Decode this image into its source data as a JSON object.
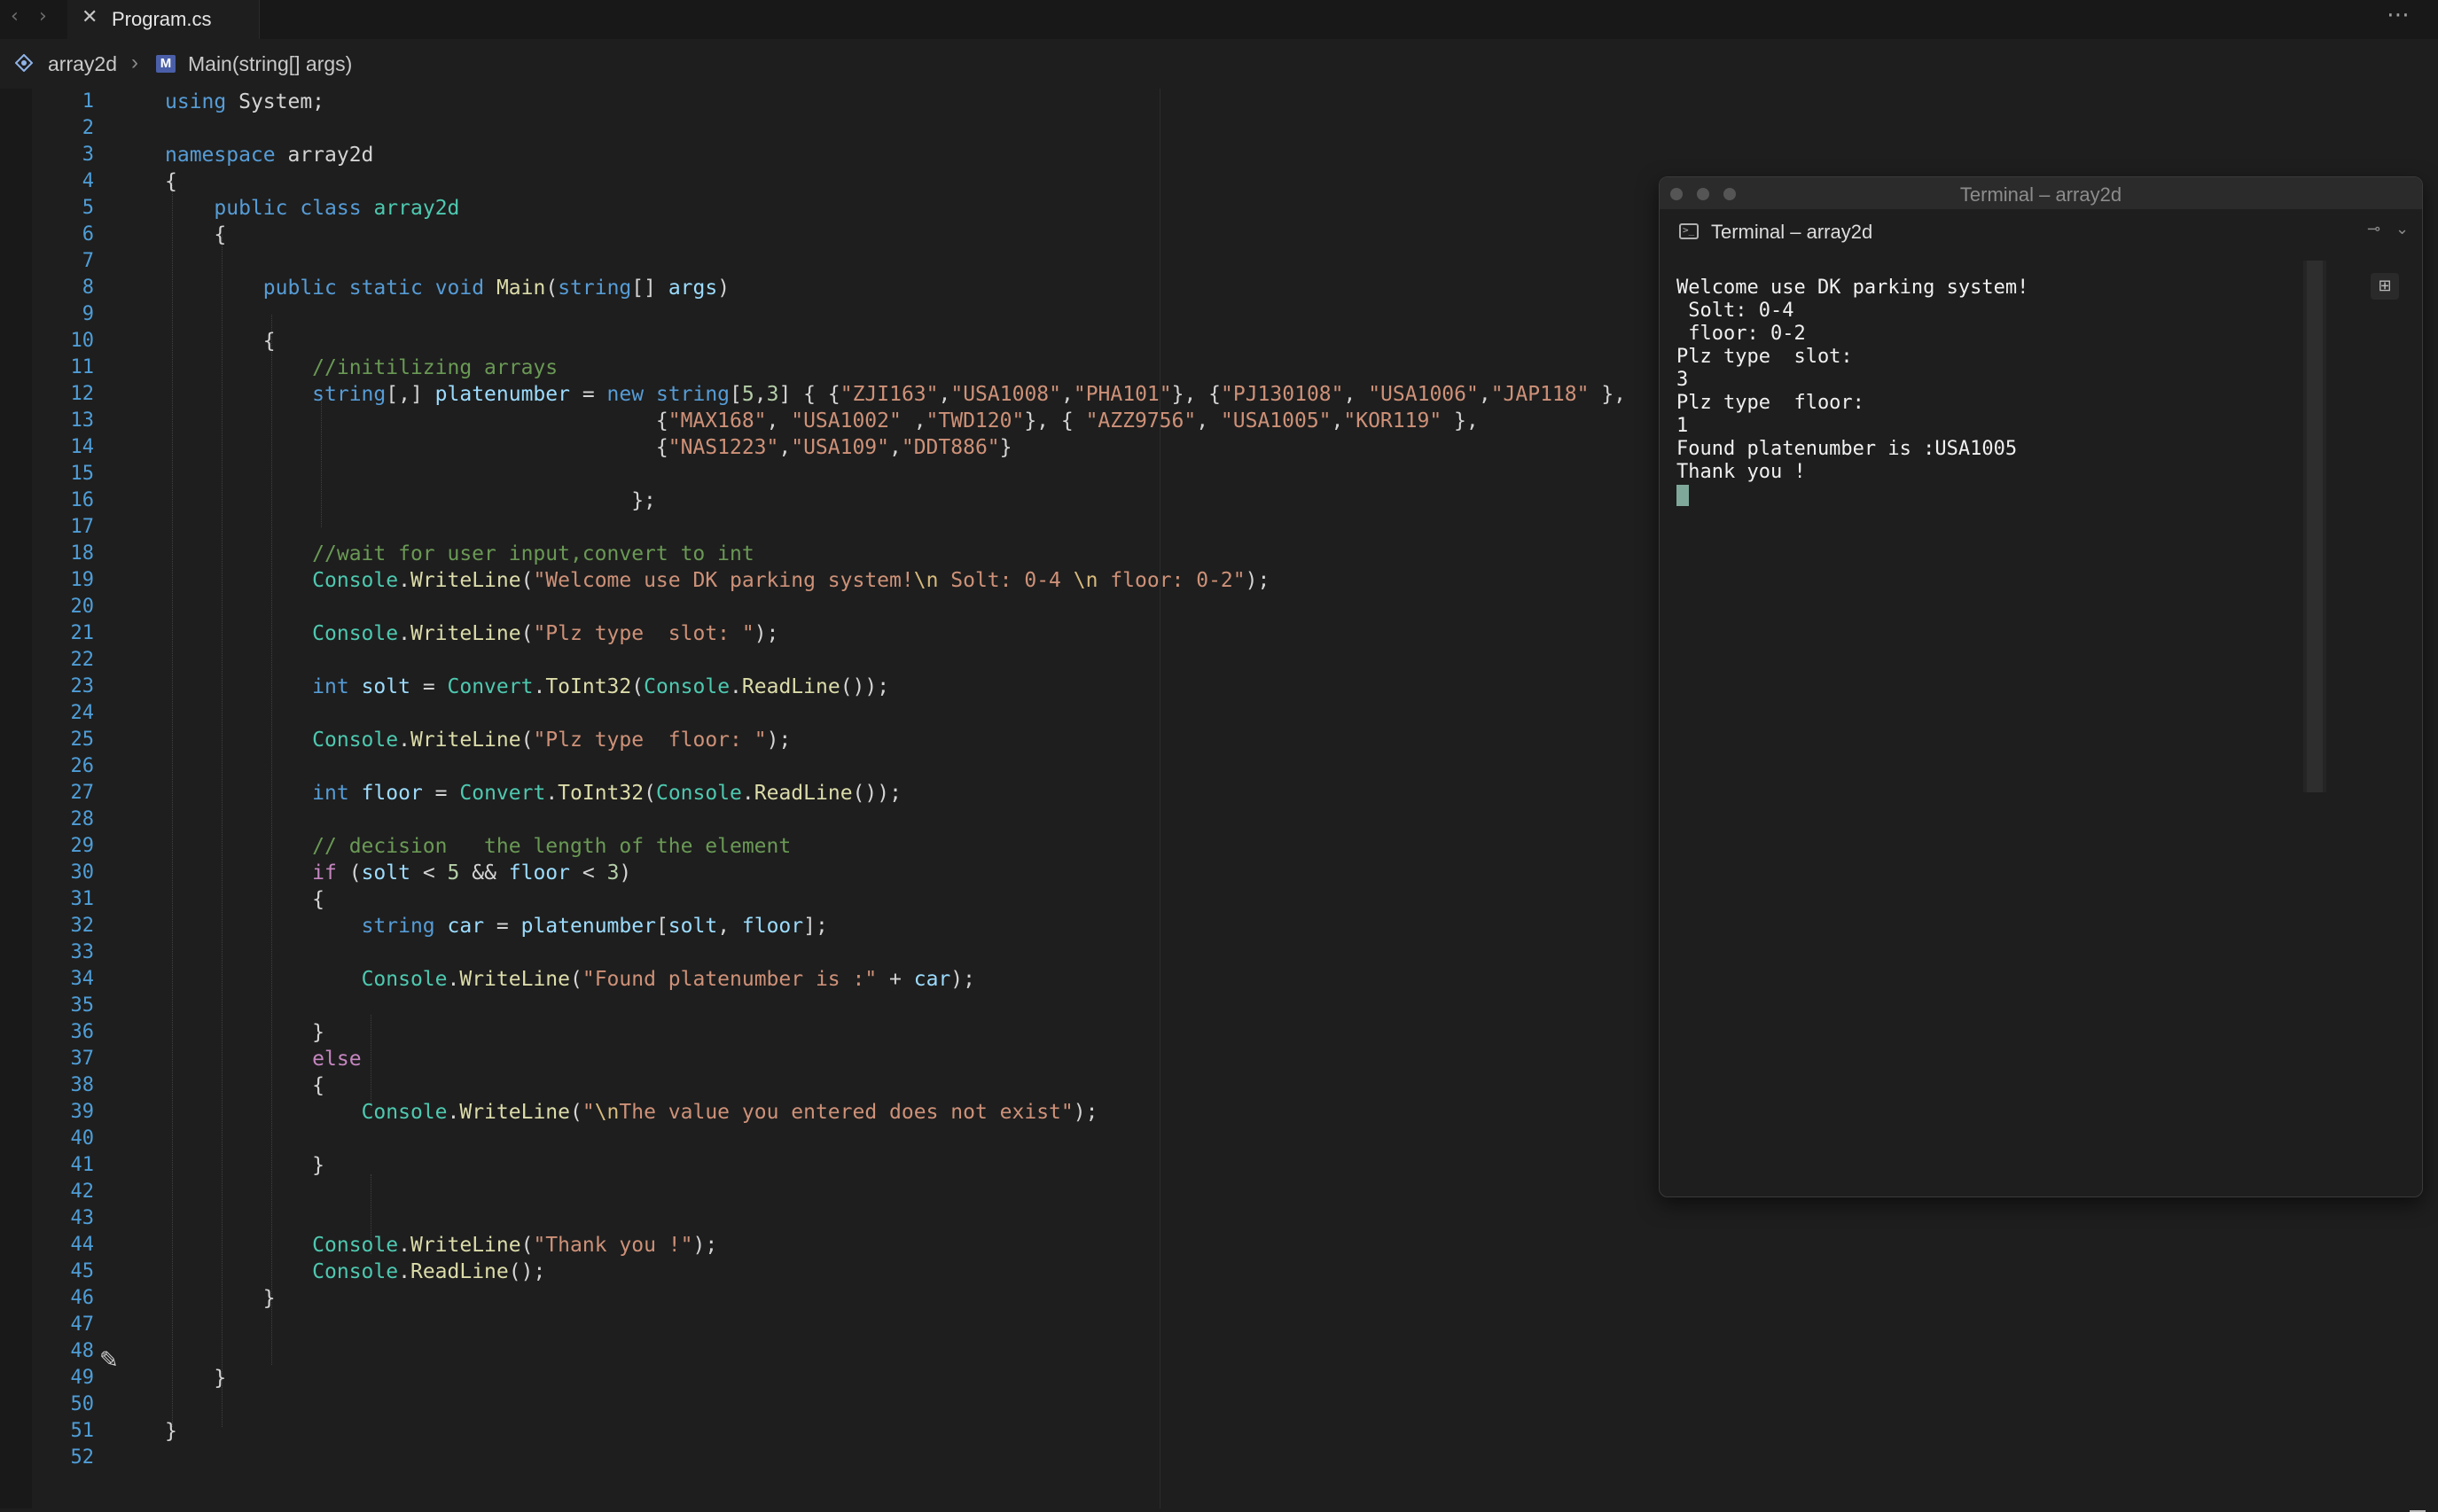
{
  "tabbar": {
    "back_icon": "chevron-left-icon",
    "forward_icon": "chevron-right-icon",
    "active_tab": {
      "label": "Program.cs",
      "close_icon": "close-icon"
    },
    "more_icon": "ellipsis-icon"
  },
  "breadcrumb": {
    "namespace": "array2d",
    "separator": "›",
    "method": "Main(string[] args)"
  },
  "editor": {
    "line_count": 52,
    "lines": [
      [
        [
          "kw",
          "using"
        ],
        [
          "t",
          " System;"
        ]
      ],
      [],
      [
        [
          "kw",
          "namespace"
        ],
        [
          "t",
          " array2d"
        ]
      ],
      [
        [
          "t",
          "{"
        ]
      ],
      [
        [
          "t",
          "    "
        ],
        [
          "kw",
          "public"
        ],
        [
          "t",
          " "
        ],
        [
          "kw",
          "class"
        ],
        [
          "t",
          " "
        ],
        [
          "ty",
          "array2d"
        ]
      ],
      [
        [
          "t",
          "    {"
        ]
      ],
      [],
      [
        [
          "t",
          "        "
        ],
        [
          "kw",
          "public"
        ],
        [
          "t",
          " "
        ],
        [
          "kw",
          "static"
        ],
        [
          "t",
          " "
        ],
        [
          "kw",
          "void"
        ],
        [
          "t",
          " "
        ],
        [
          "fn",
          "Main"
        ],
        [
          "t",
          "("
        ],
        [
          "kw",
          "string"
        ],
        [
          "t",
          "[] "
        ],
        [
          "var",
          "args"
        ],
        [
          "t",
          ")"
        ]
      ],
      [],
      [
        [
          "t",
          "        {"
        ]
      ],
      [
        [
          "t",
          "            "
        ],
        [
          "cmt",
          "//initilizing arrays"
        ]
      ],
      [
        [
          "t",
          "            "
        ],
        [
          "kw",
          "string"
        ],
        [
          "t",
          "[,] "
        ],
        [
          "var",
          "platenumber"
        ],
        [
          "t",
          " = "
        ],
        [
          "kw",
          "new"
        ],
        [
          "t",
          " "
        ],
        [
          "kw",
          "string"
        ],
        [
          "t",
          "["
        ],
        [
          "num",
          "5"
        ],
        [
          "t",
          ","
        ],
        [
          "num",
          "3"
        ],
        [
          "t",
          "] { {"
        ],
        [
          "str",
          "\"ZJI163\""
        ],
        [
          "t",
          ","
        ],
        [
          "str",
          "\"USA1008\""
        ],
        [
          "t",
          ","
        ],
        [
          "str",
          "\"PHA101\""
        ],
        [
          "t",
          "}, {"
        ],
        [
          "str",
          "\"PJ130108\""
        ],
        [
          "t",
          ", "
        ],
        [
          "str",
          "\"USA1006\""
        ],
        [
          "t",
          ","
        ],
        [
          "str",
          "\"JAP118\""
        ],
        [
          "t",
          " },"
        ]
      ],
      [
        [
          "t",
          "                                        {"
        ],
        [
          "str",
          "\"MAX168\""
        ],
        [
          "t",
          ", "
        ],
        [
          "str",
          "\"USA1002\""
        ],
        [
          "t",
          " ,"
        ],
        [
          "str",
          "\"TWD120\""
        ],
        [
          "t",
          "}, { "
        ],
        [
          "str",
          "\"AZZ9756\""
        ],
        [
          "t",
          ", "
        ],
        [
          "str",
          "\"USA1005\""
        ],
        [
          "t",
          ","
        ],
        [
          "str",
          "\"KOR119\""
        ],
        [
          "t",
          " },"
        ]
      ],
      [
        [
          "t",
          "                                        {"
        ],
        [
          "str",
          "\"NAS1223\""
        ],
        [
          "t",
          ","
        ],
        [
          "str",
          "\"USA109\""
        ],
        [
          "t",
          ","
        ],
        [
          "str",
          "\"DDT886\""
        ],
        [
          "t",
          "}"
        ]
      ],
      [],
      [
        [
          "t",
          "                                      };"
        ]
      ],
      [],
      [
        [
          "t",
          "            "
        ],
        [
          "cmt",
          "//wait for user input,convert to int"
        ]
      ],
      [
        [
          "t",
          "            "
        ],
        [
          "ty",
          "Console"
        ],
        [
          "t",
          "."
        ],
        [
          "fn",
          "WriteLine"
        ],
        [
          "t",
          "("
        ],
        [
          "str",
          "\"Welcome use DK parking system!"
        ],
        [
          "esc",
          "\\n"
        ],
        [
          "str",
          " Solt: 0-4 "
        ],
        [
          "esc",
          "\\n"
        ],
        [
          "str",
          " floor: 0-2\""
        ],
        [
          "t",
          ");"
        ]
      ],
      [],
      [
        [
          "t",
          "            "
        ],
        [
          "ty",
          "Console"
        ],
        [
          "t",
          "."
        ],
        [
          "fn",
          "WriteLine"
        ],
        [
          "t",
          "("
        ],
        [
          "str",
          "\"Plz type  slot: \""
        ],
        [
          "t",
          ");"
        ]
      ],
      [],
      [
        [
          "t",
          "            "
        ],
        [
          "kw",
          "int"
        ],
        [
          "t",
          " "
        ],
        [
          "var",
          "solt"
        ],
        [
          "t",
          " = "
        ],
        [
          "ty",
          "Convert"
        ],
        [
          "t",
          "."
        ],
        [
          "fn",
          "ToInt32"
        ],
        [
          "t",
          "("
        ],
        [
          "ty",
          "Console"
        ],
        [
          "t",
          "."
        ],
        [
          "fn",
          "ReadLine"
        ],
        [
          "t",
          "());"
        ]
      ],
      [],
      [
        [
          "t",
          "            "
        ],
        [
          "ty",
          "Console"
        ],
        [
          "t",
          "."
        ],
        [
          "fn",
          "WriteLine"
        ],
        [
          "t",
          "("
        ],
        [
          "str",
          "\"Plz type  floor: \""
        ],
        [
          "t",
          ");"
        ]
      ],
      [],
      [
        [
          "t",
          "            "
        ],
        [
          "kw",
          "int"
        ],
        [
          "t",
          " "
        ],
        [
          "var",
          "floor"
        ],
        [
          "t",
          " = "
        ],
        [
          "ty",
          "Convert"
        ],
        [
          "t",
          "."
        ],
        [
          "fn",
          "ToInt32"
        ],
        [
          "t",
          "("
        ],
        [
          "ty",
          "Console"
        ],
        [
          "t",
          "."
        ],
        [
          "fn",
          "ReadLine"
        ],
        [
          "t",
          "());"
        ]
      ],
      [],
      [
        [
          "t",
          "            "
        ],
        [
          "cmt",
          "// decision   the length of the element"
        ]
      ],
      [
        [
          "t",
          "            "
        ],
        [
          "ctl",
          "if"
        ],
        [
          "t",
          " ("
        ],
        [
          "var",
          "solt"
        ],
        [
          "t",
          " < "
        ],
        [
          "num",
          "5"
        ],
        [
          "t",
          " && "
        ],
        [
          "var",
          "floor"
        ],
        [
          "t",
          " < "
        ],
        [
          "num",
          "3"
        ],
        [
          "t",
          ")"
        ]
      ],
      [
        [
          "t",
          "            {"
        ]
      ],
      [
        [
          "t",
          "                "
        ],
        [
          "kw",
          "string"
        ],
        [
          "t",
          " "
        ],
        [
          "var",
          "car"
        ],
        [
          "t",
          " = "
        ],
        [
          "var",
          "platenumber"
        ],
        [
          "t",
          "["
        ],
        [
          "var",
          "solt"
        ],
        [
          "t",
          ", "
        ],
        [
          "var",
          "floor"
        ],
        [
          "t",
          "];"
        ]
      ],
      [],
      [
        [
          "t",
          "                "
        ],
        [
          "ty",
          "Console"
        ],
        [
          "t",
          "."
        ],
        [
          "fn",
          "WriteLine"
        ],
        [
          "t",
          "("
        ],
        [
          "str",
          "\"Found platenumber is :\""
        ],
        [
          "t",
          " + "
        ],
        [
          "var",
          "car"
        ],
        [
          "t",
          ");"
        ]
      ],
      [],
      [
        [
          "t",
          "            }"
        ]
      ],
      [
        [
          "t",
          "            "
        ],
        [
          "ctl",
          "else"
        ]
      ],
      [
        [
          "t",
          "            {"
        ]
      ],
      [
        [
          "t",
          "                "
        ],
        [
          "ty",
          "Console"
        ],
        [
          "t",
          "."
        ],
        [
          "fn",
          "WriteLine"
        ],
        [
          "t",
          "("
        ],
        [
          "str",
          "\""
        ],
        [
          "esc",
          "\\n"
        ],
        [
          "str",
          "The value you entered does not exist\""
        ],
        [
          "t",
          ");"
        ]
      ],
      [],
      [
        [
          "t",
          "            }"
        ]
      ],
      [],
      [],
      [
        [
          "t",
          "            "
        ],
        [
          "ty",
          "Console"
        ],
        [
          "t",
          "."
        ],
        [
          "fn",
          "WriteLine"
        ],
        [
          "t",
          "("
        ],
        [
          "str",
          "\"Thank you !\""
        ],
        [
          "t",
          ");"
        ]
      ],
      [
        [
          "t",
          "            "
        ],
        [
          "ty",
          "Console"
        ],
        [
          "t",
          "."
        ],
        [
          "fn",
          "ReadLine"
        ],
        [
          "t",
          "();"
        ]
      ],
      [
        [
          "t",
          "        }"
        ]
      ],
      [],
      [],
      [
        [
          "t",
          "    }"
        ]
      ],
      [],
      [
        [
          "t",
          "}"
        ]
      ],
      []
    ]
  },
  "terminal": {
    "window_title": "Terminal – array2d",
    "tab_title": "Terminal – array2d",
    "terminal_icon": "terminal-icon",
    "pin_icon": "pin-icon",
    "chevron_icon": "chevron-down-icon",
    "new_terminal_icon": "new-terminal-icon",
    "output": [
      "Welcome use DK parking system!",
      " Solt: 0-4",
      " floor: 0-2",
      "Plz type  slot:",
      "3",
      "Plz type  floor:",
      "1",
      "Found platenumber is :USA1005",
      "Thank you !"
    ]
  },
  "colors": {
    "keyword": "#569cd6",
    "control": "#c586c0",
    "type": "#4ec9b0",
    "function": "#dcdcaa",
    "variable": "#9cdcfe",
    "string": "#ce9178",
    "escape": "#d7ba7d",
    "number": "#b5cea8",
    "comment": "#6a9955",
    "line_number": "#4f9ed8"
  }
}
